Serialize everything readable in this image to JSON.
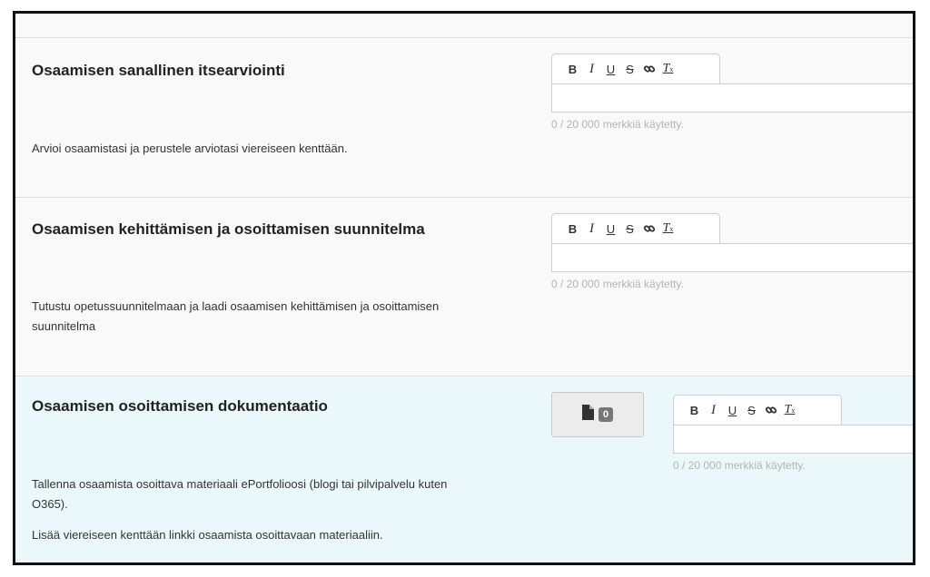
{
  "sections": [
    {
      "title": "Osaamisen sanallinen itsearviointi",
      "description": [
        "Arvioi osaamistasi ja perustele arviotasi viereiseen kenttään."
      ],
      "counter": "0 / 20 000 merkkiä käytetty."
    },
    {
      "title": "Osaamisen kehittämisen ja osoittamisen suunnitelma",
      "description": [
        "Tutustu opetussuunnitelmaan ja laadi osaamisen kehittämisen ja osoittamisen suunnitelma"
      ],
      "counter": "0 / 20 000 merkkiä käytetty."
    },
    {
      "title": "Osaamisen osoittamisen dokumentaatio",
      "description": [
        "Tallenna osaamista osoittava materiaali ePortfolioosi (blogi tai pilvipalvelu kuten O365).",
        "Lisää viereiseen kenttään linkki osaamista osoittavaan materiaaliin."
      ],
      "counter": "0 / 20 000 merkkiä käytetty.",
      "attachment_count": "0"
    }
  ],
  "toolbar": {
    "bold": "B",
    "italic": "I",
    "underline": "U",
    "strike": "S",
    "link_icon": "link-icon",
    "clear_format": "T",
    "clear_format_sub": "x"
  },
  "icons": {
    "attach": "document-icon"
  },
  "colors": {
    "panel_bg": "#f9f9f9",
    "highlight_bg": "#eaf8fb",
    "counter_text": "#b4b4b4",
    "badge_bg": "#777777"
  }
}
